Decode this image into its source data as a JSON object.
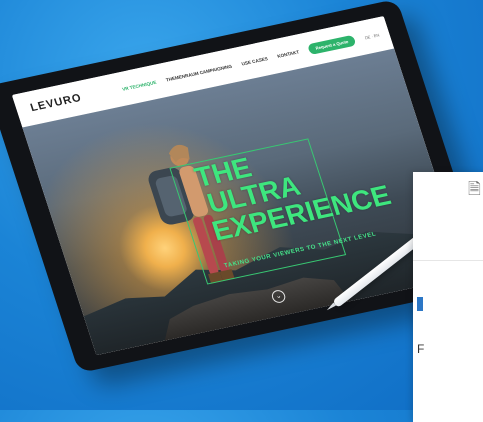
{
  "nav": {
    "logo": "LEVURO",
    "links": [
      "VR TECHNIQUE",
      "THEMENRAUM CAMPAIGNING",
      "USE CASES",
      "KONTAKT"
    ],
    "cta": "Request a Quote",
    "lang": "DE · EN"
  },
  "hero": {
    "headline": [
      "THE",
      "ULTRA",
      "EXPERIENCE"
    ],
    "tagline": "TAKING YOUR VIEWERS TO THE NEXT LEVEL"
  },
  "card": {
    "icon": "document-icon",
    "letter": "F"
  },
  "colors": {
    "background": "#1b84d6",
    "accent": "#2db36b",
    "headline": "#3ee67e"
  }
}
